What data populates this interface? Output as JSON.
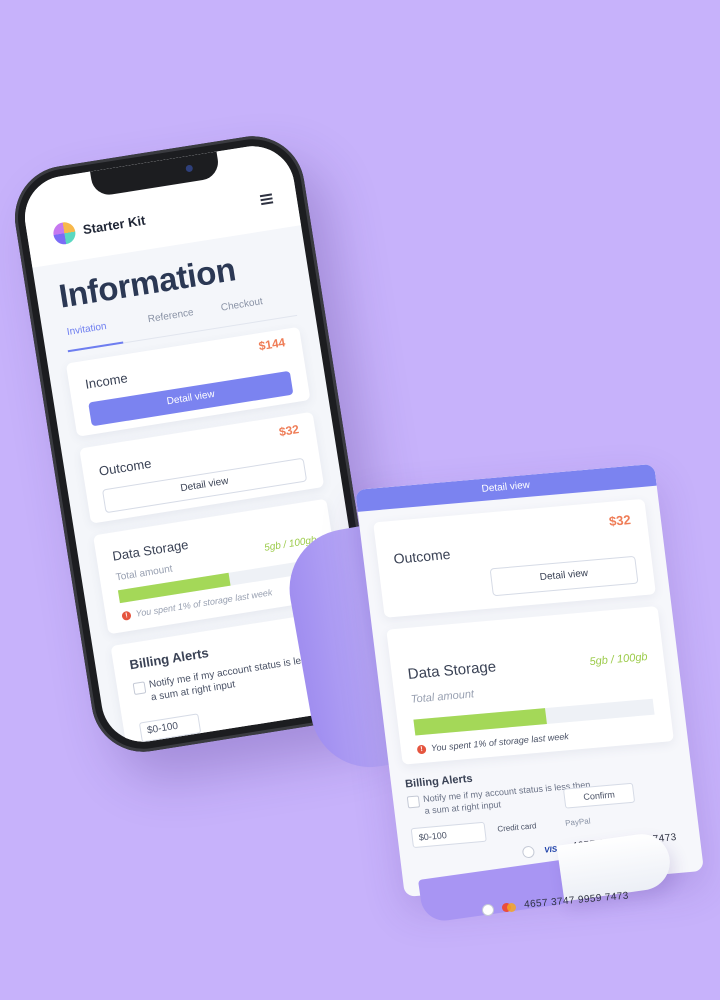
{
  "app": {
    "title": "Starter Kit"
  },
  "page": {
    "title": "Information"
  },
  "tabs": [
    {
      "label": "Invitation",
      "active": true
    },
    {
      "label": "Reference",
      "active": false
    },
    {
      "label": "Checkout",
      "active": false
    }
  ],
  "income": {
    "title": "Income",
    "amount": "$144",
    "button": "Detail view"
  },
  "outcome": {
    "title": "Outcome",
    "amount": "$32",
    "button": "Detail view"
  },
  "storage": {
    "title": "Data Storage",
    "subtitle": "Total amount",
    "value": "5gb / 100gb",
    "fill_percent": 55,
    "alert": "You spent 1% of storage last week"
  },
  "billing": {
    "title": "Billing Alerts",
    "notify_text": "Notify me if my account status is less then a sum at right input",
    "select_value": "$0-100",
    "confirm": "Confirm",
    "payment_tabs": [
      "Credit card",
      "PayPal"
    ],
    "cards": [
      {
        "brand": "VISA",
        "number": "4657 3747 9959 7473"
      },
      {
        "brand": "mastercard",
        "number": "4657 3747 9959 7473"
      }
    ]
  },
  "colors": {
    "background": "#c7b2fb",
    "accent": "#7b83f0",
    "amount": "#ef7d57",
    "storage": "#a4d858",
    "alert": "#e5553f"
  }
}
